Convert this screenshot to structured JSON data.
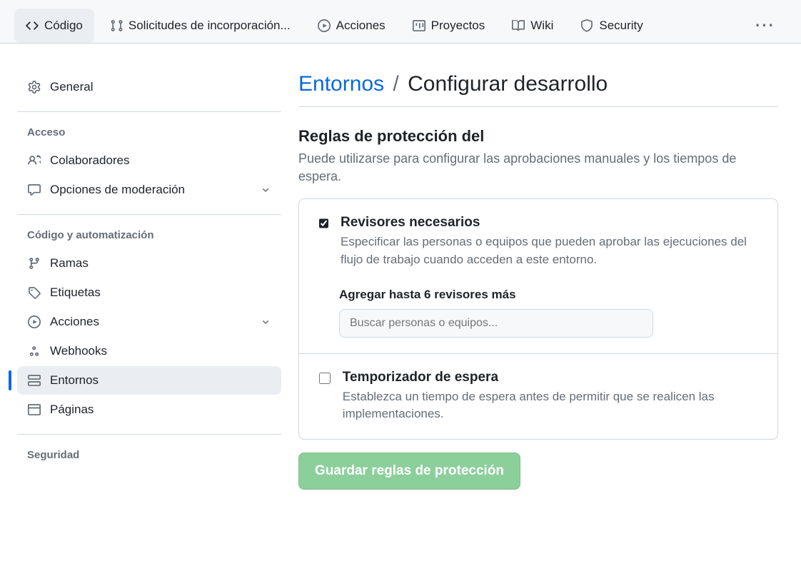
{
  "topnav": {
    "code": "Código",
    "pulls": "Solicitudes de incorporación...",
    "actions": "Acciones",
    "projects": "Proyectos",
    "wiki": "Wiki",
    "security": "Security"
  },
  "sidebar": {
    "general": "General",
    "heading_access": "Acceso",
    "collaborators": "Colaboradores",
    "moderation": "Opciones de moderación",
    "heading_code": "Código y automatización",
    "branches": "Ramas",
    "tags": "Etiquetas",
    "actions": "Acciones",
    "webhooks": "Webhooks",
    "environments": "Entornos",
    "pages": "Páginas",
    "heading_security": "Seguridad"
  },
  "breadcrumb": {
    "parent": "Entornos",
    "current": "Configurar desarrollo"
  },
  "section": {
    "title": "Reglas de protección del",
    "desc": "Puede utilizarse para configurar las aprobaciones manuales y los tiempos de espera."
  },
  "reviewers": {
    "title": "Revisores necesarios",
    "desc": "Especificar las personas o equipos que pueden aprobar las ejecuciones del flujo de trabajo cuando acceden a este entorno.",
    "add_label": "Agregar hasta 6 revisores más",
    "placeholder": "Buscar personas o equipos..."
  },
  "wait": {
    "title": "Temporizador de espera",
    "desc": "Establezca un tiempo de espera antes de permitir que se realicen las implementaciones."
  },
  "save_button": "Guardar reglas de protección"
}
